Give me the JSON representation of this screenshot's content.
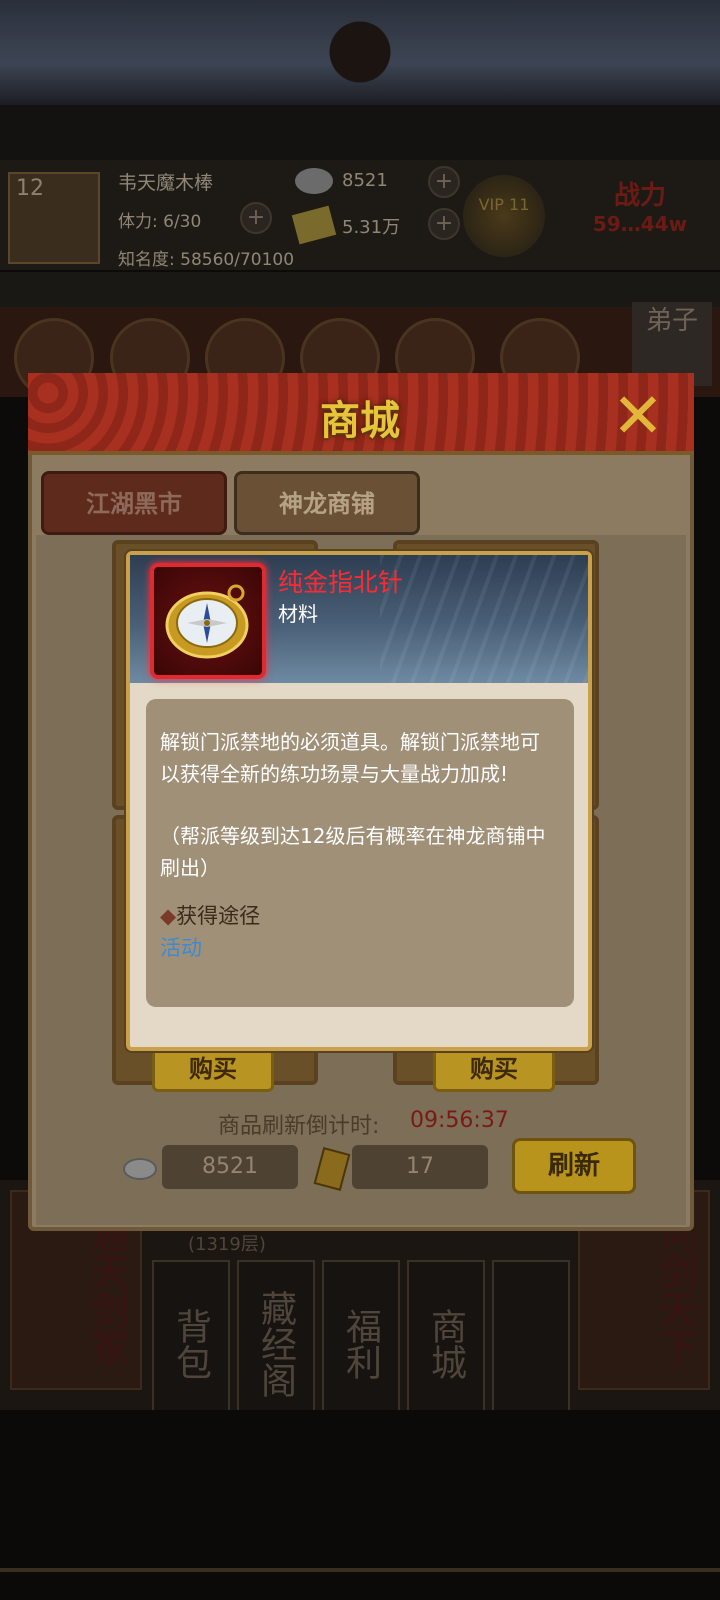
{
  "player": {
    "level": "12",
    "name": "韦天魔木棒",
    "stamina_label": "体力: 6/30",
    "fame_label": "知名度: 58560/70100",
    "silver": "8521",
    "gold": "5.31万",
    "vip": "VIP 11",
    "power_label": "战力",
    "power_value": "59…44w"
  },
  "disciple_tag": "弟子",
  "bottom_menu": {
    "left_side": "通天剑冢",
    "right_side": "问剑天下",
    "left_sub": "(1319层)",
    "buttons": [
      "背包",
      "藏经阁",
      "福利",
      "商城"
    ]
  },
  "shop": {
    "title": "商城",
    "tabs": [
      "江湖黑市",
      "神龙商铺"
    ],
    "buy_label": "购买",
    "countdown_label": "商品刷新倒计时:",
    "countdown_time": "09:56:37",
    "silver_amount": "8521",
    "token_amount": "17",
    "refresh_label": "刷新"
  },
  "tooltip": {
    "item_name": "纯金指北针",
    "item_type": "材料",
    "description": "解锁门派禁地的必须道具。解锁门派禁地可以获得全新的练功场景与大量战力加成!",
    "note": "（帮派等级到达12级后有概率在神龙商铺中刷出）",
    "source_title": "获得途径",
    "source_link": "活动"
  },
  "colors": {
    "item_name": "#ff2a30",
    "countdown": "#7a1a14",
    "link": "#3a8ad8",
    "gold_button": "#b8941c"
  }
}
